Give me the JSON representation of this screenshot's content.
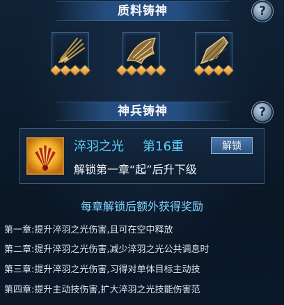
{
  "material_section": {
    "title": "质料铸神",
    "help_label": "?",
    "slots": [
      {
        "icon": "golden-wing-icon",
        "stars": 4
      },
      {
        "icon": "golden-wing-icon",
        "stars": 5
      },
      {
        "icon": "golden-wing-icon",
        "stars": 4
      }
    ]
  },
  "weapon_section": {
    "title": "神兵铸神",
    "help_label": "?",
    "skill": {
      "icon": "feather-glow-icon",
      "name": "淬羽之光",
      "level": "第16重",
      "unlock_button": "解锁",
      "unlock_condition": "解锁第一章“起”后升下级"
    }
  },
  "rewards": {
    "title": "每章解锁后额外获得奖励",
    "chapters": [
      "第一章:提升淬羽之光伤害,且可在空中释放",
      "第二章:提升淬羽之光伤害,减少淬羽之光公共调息时",
      "第三章:提升淬羽之光伤害,习得对单体目标主动技",
      "第四章:提升主动技伤害,扩大淬羽之光技能伤害范"
    ]
  },
  "colors": {
    "accent_text": "#5fd0ff",
    "star": "#f0a030",
    "panel": "#0d1b2c"
  }
}
